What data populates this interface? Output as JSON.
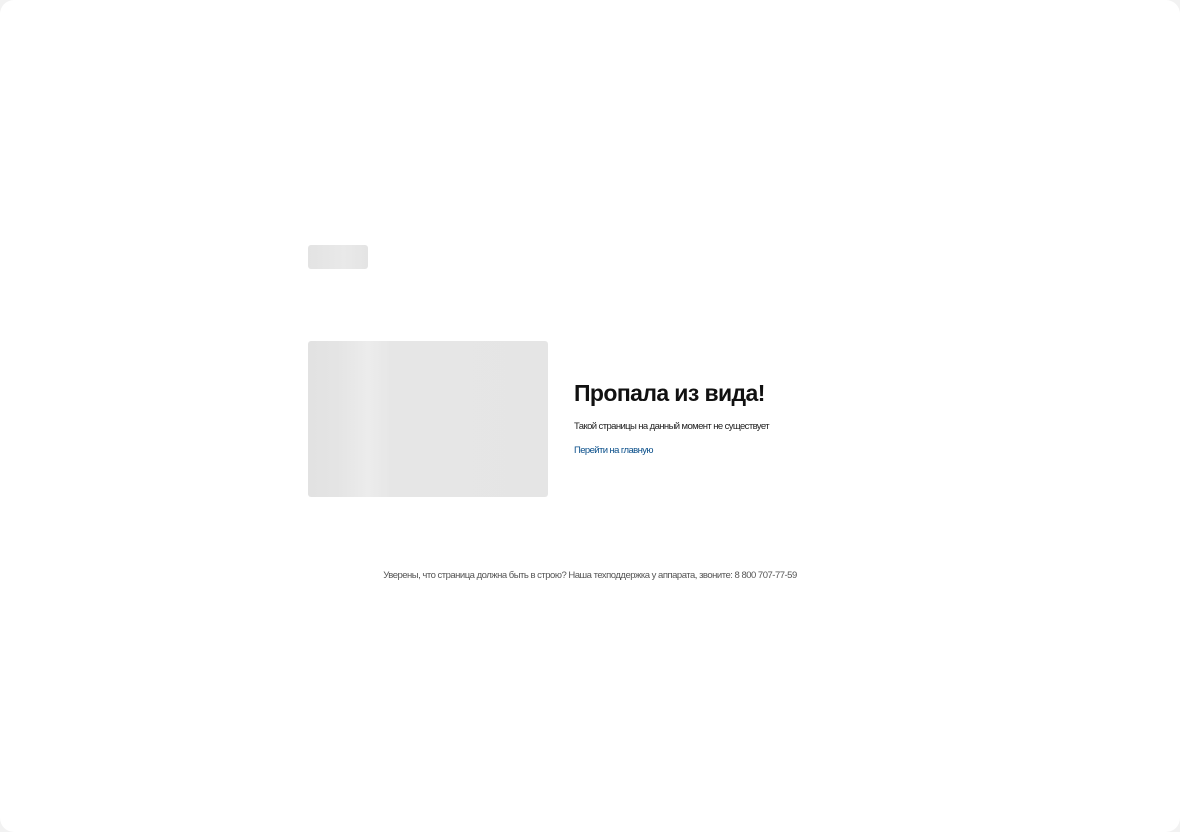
{
  "error_page": {
    "title": "Пропала из вида!",
    "subtitle": "Такой страницы на данный момент не существует",
    "home_link_label": "Перейти на главную",
    "support_note": "Уверены, что страница должна быть в строю? Наша техподдержка у аппарата, звоните: 8 800 707-77-59"
  },
  "colors": {
    "link": "#0a4f8a",
    "placeholder": "#e5e5e5",
    "title": "#111111"
  }
}
